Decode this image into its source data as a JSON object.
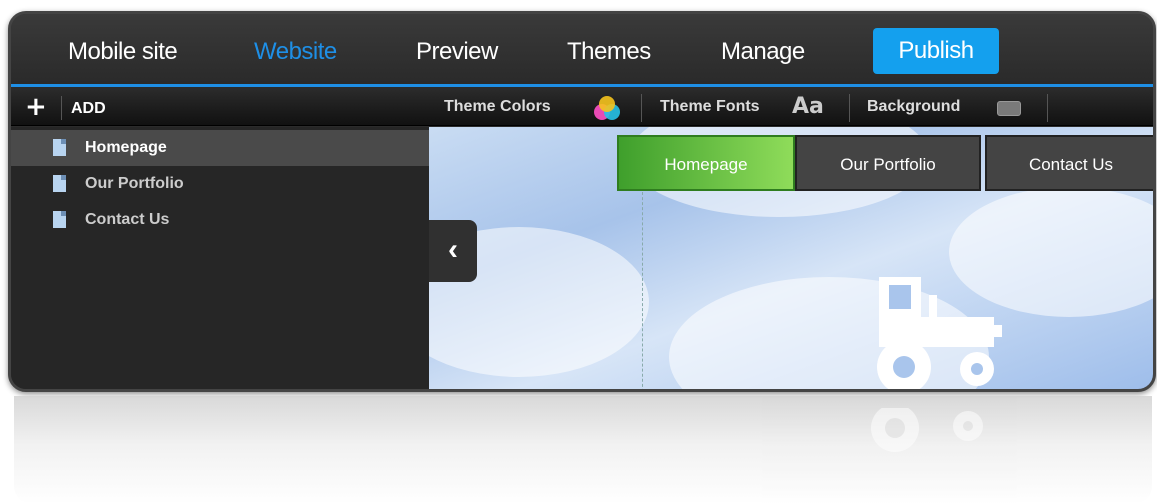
{
  "topnav": {
    "items": [
      {
        "label": "Mobile site",
        "active": false
      },
      {
        "label": "Website",
        "active": true
      },
      {
        "label": "Preview",
        "active": false
      },
      {
        "label": "Themes",
        "active": false
      },
      {
        "label": "Manage",
        "active": false
      }
    ],
    "publish_label": "Publish"
  },
  "toolbar": {
    "add_label": "ADD",
    "plus_glyph": "+",
    "theme_colors_label": "Theme Colors",
    "theme_fonts_label": "Theme Fonts",
    "theme_fonts_glyph": "Aa",
    "background_label": "Background"
  },
  "sidebar": {
    "pages": [
      {
        "label": "Homepage",
        "selected": true
      },
      {
        "label": "Our Portfolio",
        "selected": false
      },
      {
        "label": "Contact Us",
        "selected": false
      }
    ]
  },
  "preview": {
    "collapse_glyph": "‹",
    "site_nav": [
      {
        "label": "Homepage",
        "active": true
      },
      {
        "label": "Our Portfolio",
        "active": false
      },
      {
        "label": "Contact Us",
        "active": false
      }
    ]
  },
  "colors": {
    "accent": "#1e8fe6",
    "publish": "#14a0ee",
    "active_tab": "#5cbf3a"
  },
  "icons": [
    "page-icon",
    "color-wheel-icon",
    "font-aa-icon",
    "background-swatch-icon",
    "chevron-left-icon",
    "tractor-icon"
  ]
}
